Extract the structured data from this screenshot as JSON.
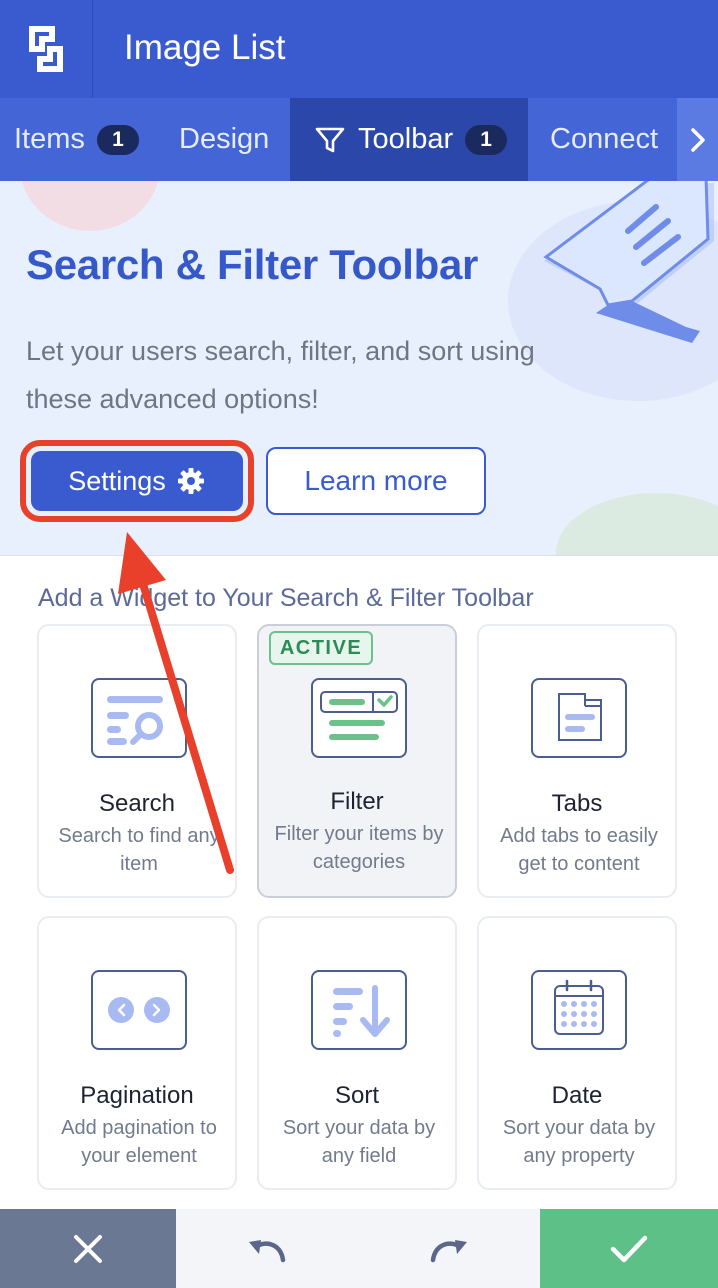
{
  "header": {
    "title": "Image List",
    "logo": "app-logo-icon"
  },
  "tabs": [
    {
      "label": "Items",
      "badge": "1"
    },
    {
      "label": "Design"
    },
    {
      "label": "Toolbar",
      "badge": "1",
      "icon": "filter-icon",
      "active": true
    },
    {
      "label": "Connect"
    }
  ],
  "hero": {
    "title": "Search & Filter Toolbar",
    "description": "Let your users search, filter, and sort using these advanced options!",
    "settings_label": "Settings",
    "learn_more_label": "Learn more"
  },
  "widgets": {
    "heading": "Add a Widget to Your Search & Filter Toolbar",
    "active_badge": "ACTIVE",
    "items": [
      {
        "title": "Search",
        "desc": "Search to find any item",
        "icon": "search-widget-icon"
      },
      {
        "title": "Filter",
        "desc": "Filter your items by categories",
        "icon": "filter-widget-icon",
        "active": true
      },
      {
        "title": "Tabs",
        "desc": "Add tabs to easily get to content",
        "icon": "tabs-widget-icon"
      },
      {
        "title": "Pagination",
        "desc": "Add pagination to your element",
        "icon": "pagination-widget-icon"
      },
      {
        "title": "Sort",
        "desc": "Sort your data by any field",
        "icon": "sort-widget-icon"
      },
      {
        "title": "Date",
        "desc": "Sort your data by any property",
        "icon": "date-widget-icon"
      }
    ]
  },
  "bottom_bar": {
    "cancel": "close-icon",
    "undo": "undo-icon",
    "redo": "redo-icon",
    "confirm": "check-icon"
  },
  "colors": {
    "primary": "#3a5bd0",
    "tab_active": "#2c47aa",
    "highlight": "#e8402a",
    "success": "#5cc087",
    "cancel_bg": "#6b7893"
  }
}
